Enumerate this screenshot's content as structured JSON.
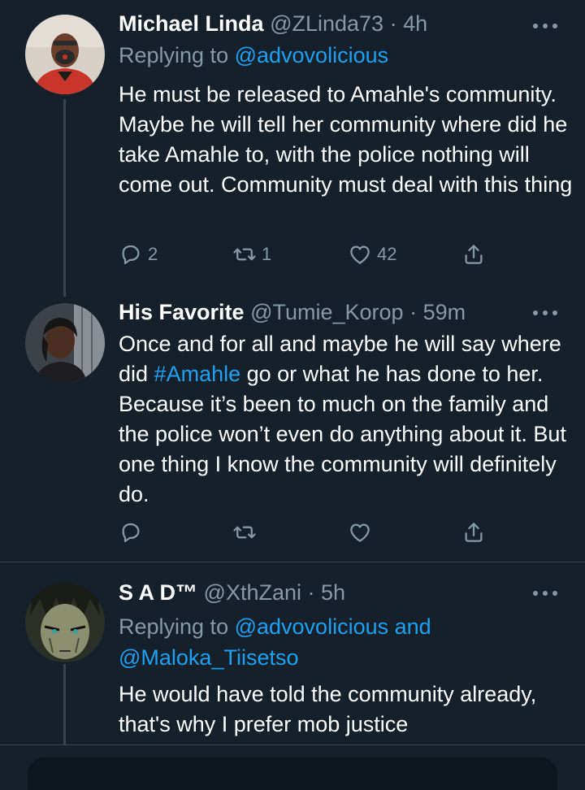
{
  "tweets": [
    {
      "name": "Michael Linda",
      "handle": "@ZLinda73",
      "time": "· 4h",
      "replying_prefix": "Replying to ",
      "replying_to": "@advovolicious",
      "body": "He must be released to Amahle's community. Maybe he will tell her community where did he take Amahle to, with the police nothing will come out. Community must deal with this thing",
      "replies": "2",
      "retweets": "1",
      "likes": "42"
    },
    {
      "name": "His Favorite",
      "handle": "@Tumie_Korop",
      "time": "· 59m",
      "body_before_tag": "Once and for all and maybe he will say where did ",
      "hashtag": "#Amahle",
      "body_after_tag": " go or what he has done to her. Because it’s been to much on the family and the police won’t even do anything about it. But one thing I know the community will definitely do.",
      "replies": "",
      "retweets": "",
      "likes": ""
    },
    {
      "name": "S A D™",
      "handle": "@XthZani",
      "time": "· 5h",
      "replying_prefix": "Replying to ",
      "replying_to": "@advovolicious",
      "replying_and": " and",
      "replying_to_2": "@Maloka_Tiisetso",
      "body": "He would have told the community already, that's why I prefer mob justice"
    }
  ],
  "colors": {
    "background": "#15202b",
    "secondary_text": "#8899a6",
    "link": "#1da1f2",
    "divider": "#38444d"
  },
  "icons": [
    "reply-icon",
    "retweet-icon",
    "like-icon",
    "share-icon",
    "more-icon"
  ]
}
